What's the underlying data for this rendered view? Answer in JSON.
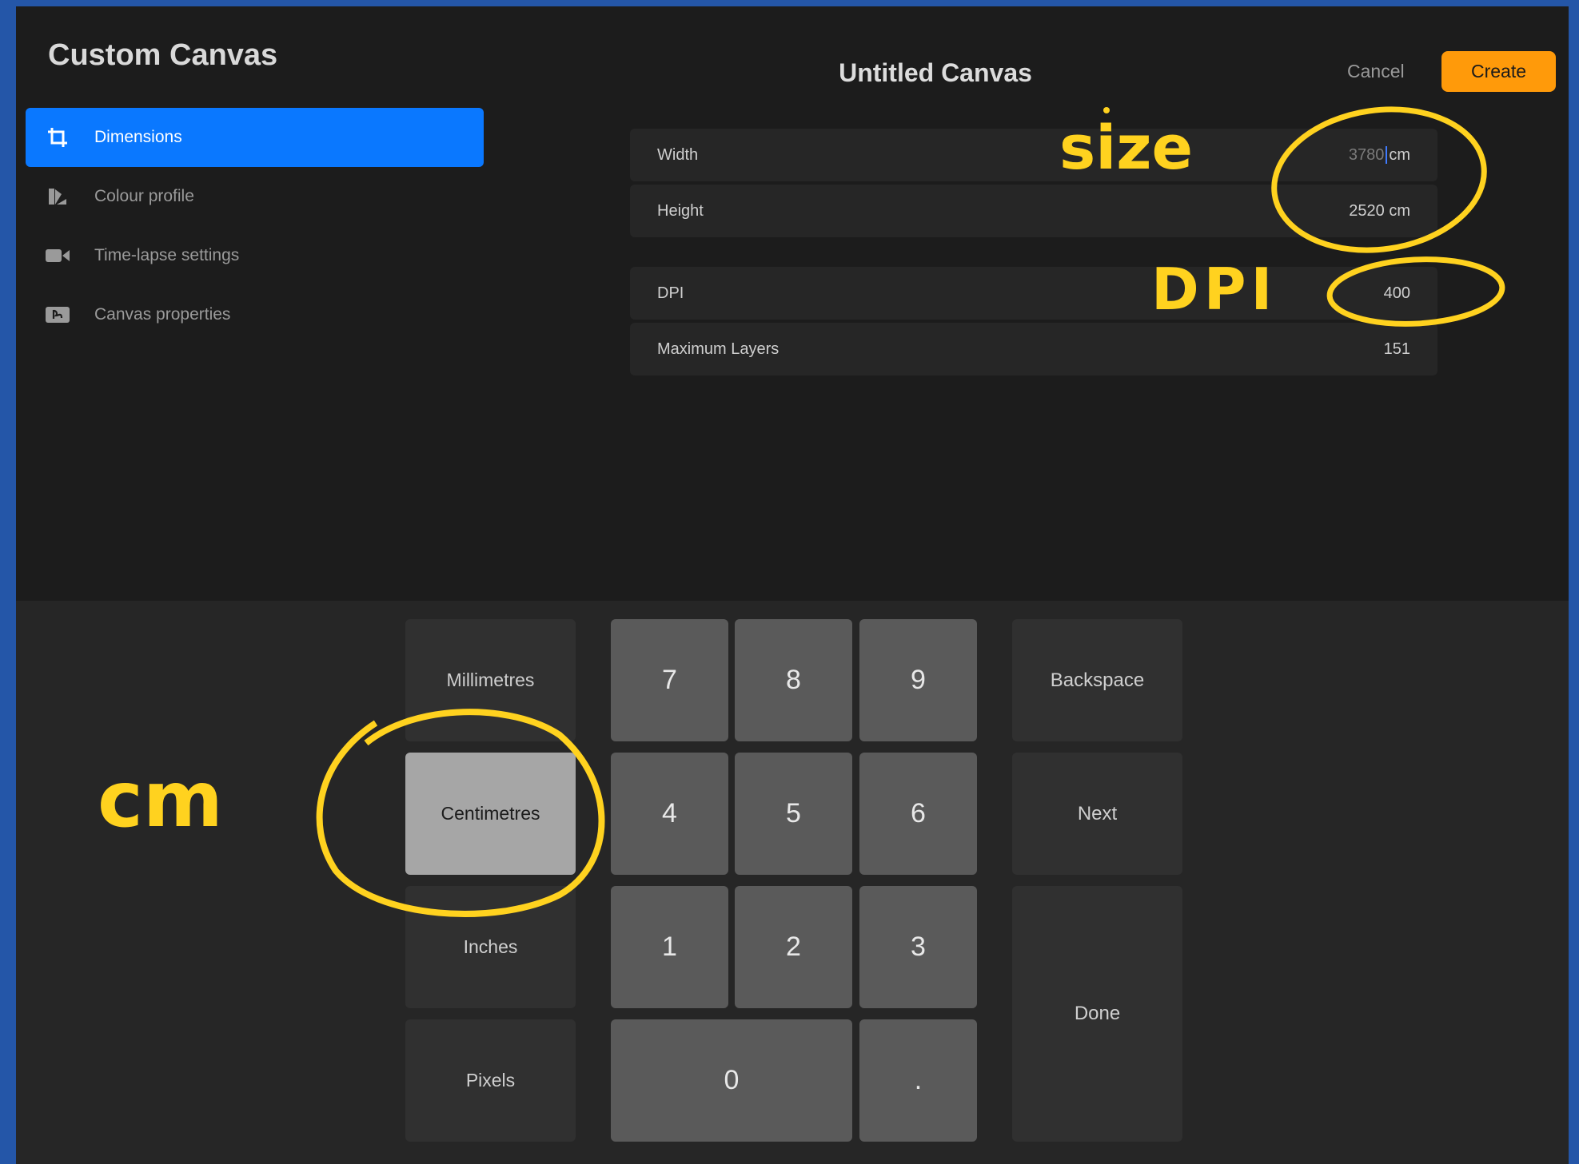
{
  "sidebar": {
    "title": "Custom Canvas",
    "items": [
      {
        "label": "Dimensions",
        "icon": "crop-icon",
        "active": true
      },
      {
        "label": "Colour profile",
        "icon": "colour-profile-icon",
        "active": false
      },
      {
        "label": "Time-lapse settings",
        "icon": "video-camera-icon",
        "active": false
      },
      {
        "label": "Canvas properties",
        "icon": "canvas-properties-icon",
        "active": false
      }
    ]
  },
  "header": {
    "title": "Untitled Canvas",
    "cancel_label": "Cancel",
    "create_label": "Create"
  },
  "fields": {
    "width": {
      "label": "Width",
      "typed": "3780",
      "unit": "cm"
    },
    "height": {
      "label": "Height",
      "value": "2520 cm"
    },
    "dpi": {
      "label": "DPI",
      "value": "400"
    },
    "max_layers": {
      "label": "Maximum Layers",
      "value": "151"
    }
  },
  "keypad": {
    "units": [
      "Millimetres",
      "Centimetres",
      "Inches",
      "Pixels"
    ],
    "selected_unit": "Centimetres",
    "digits": [
      "7",
      "8",
      "9",
      "4",
      "5",
      "6",
      "1",
      "2",
      "3",
      "0",
      "."
    ],
    "backspace_label": "Backspace",
    "next_label": "Next",
    "done_label": "Done"
  },
  "annotations": {
    "size": "size",
    "dpi": "DPI",
    "cm": "cm"
  },
  "colors": {
    "accent_blue": "#0a78ff",
    "create_orange": "#ff9a0a",
    "annotation_yellow": "#ffd21f",
    "border_blue": "#2456a8"
  }
}
